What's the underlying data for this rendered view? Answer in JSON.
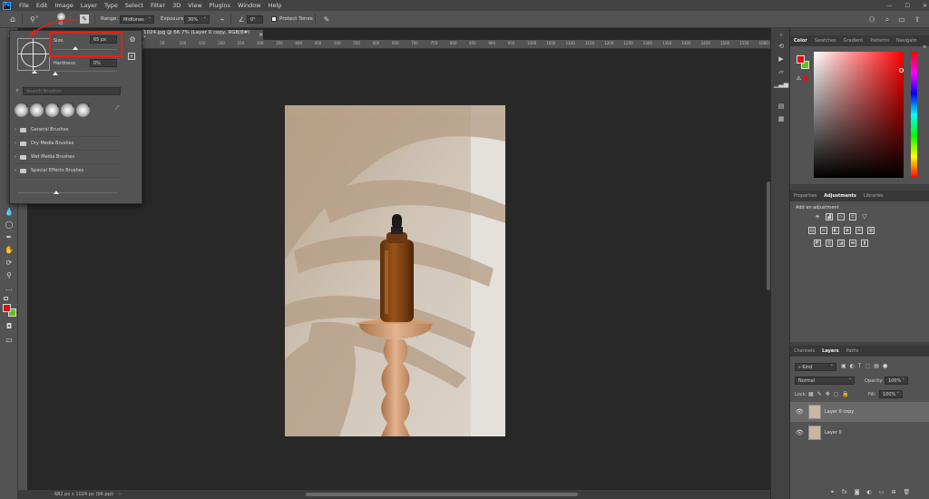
{
  "menu": {
    "items": [
      "File",
      "Edit",
      "Image",
      "Layer",
      "Type",
      "Select",
      "Filter",
      "3D",
      "View",
      "Plugins",
      "Window",
      "Help"
    ],
    "logo": "Ps"
  },
  "options": {
    "brush_size_badge": "65",
    "range_label": "Range:",
    "range_value": "Midtones",
    "exposure_label": "Exposure:",
    "exposure_value": "30%",
    "angle_value": "0°",
    "protect_tones": "Protect Tones"
  },
  "document": {
    "tab_title": "1024.jpg @ 66.7% (Layer 0 copy, RGB/8#) *",
    "status": "682 px x 1024 px (96 ppi)",
    "ruler_ticks": [
      "0",
      "50",
      "100",
      "150",
      "200",
      "250",
      "300",
      "350",
      "400",
      "450",
      "500",
      "550",
      "600",
      "650",
      "700",
      "750",
      "800",
      "850",
      "900",
      "950",
      "1000",
      "1050",
      "1100",
      "1150",
      "1200",
      "1250",
      "1300",
      "1350",
      "1400",
      "1450",
      "1500",
      "1550",
      "1600",
      "1650"
    ]
  },
  "brush_popup": {
    "size_label": "Size:",
    "size_value": "65 px",
    "hardness_label": "Hardness:",
    "hardness_value": "0%",
    "search_placeholder": "Search Brushes",
    "presets": [
      "1",
      "1",
      "1",
      "1",
      "1"
    ],
    "folders": [
      "General Brushes",
      "Dry Media Brushes",
      "Wet Media Brushes",
      "Special Effects Brushes"
    ],
    "highlight_color": "#e0221a"
  },
  "panels": {
    "color_tabs": [
      "Color",
      "Swatches",
      "Gradient",
      "Patterns",
      "Navigato"
    ],
    "foreground_color": "#e01010",
    "background_color": "#5fc21a",
    "adjust_tabs": [
      "Properties",
      "Adjustments",
      "Libraries"
    ],
    "add_adjustment": "Add an adjustment",
    "layer_tabs": [
      "Channels",
      "Layers",
      "Paths"
    ],
    "kind_label": "Kind",
    "blend_mode": "Normal",
    "opacity_label": "Opacity:",
    "opacity_value": "100%",
    "lock_label": "Lock:",
    "fill_label": "Fill:",
    "fill_value": "100%",
    "layers": [
      "Layer 0 copy",
      "Layer 0"
    ]
  }
}
